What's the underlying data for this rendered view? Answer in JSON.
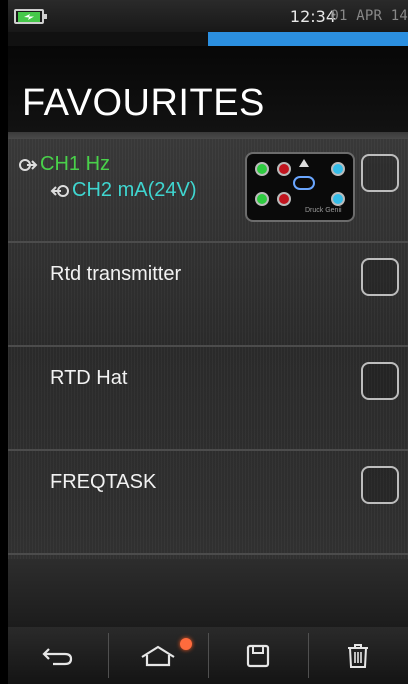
{
  "status": {
    "time": "12:34",
    "date": "01 APR 14",
    "battery_icon": "battery-charging-icon",
    "progress": 0.5
  },
  "header": {
    "title": "FAVOURITES"
  },
  "favourites": [
    {
      "channels": [
        {
          "label": "CH1 Hz",
          "color": "#49d14a"
        },
        {
          "label": "CH2 mA(24V)",
          "color": "#3fd6d0"
        }
      ],
      "device_brand": "Druck Genii",
      "checked": false
    },
    {
      "label": "Rtd transmitter",
      "checked": false
    },
    {
      "label": "RTD Hat",
      "checked": false
    },
    {
      "label": "FREQTASK",
      "checked": false
    }
  ],
  "navbar": {
    "items": [
      {
        "icon": "back-icon"
      },
      {
        "icon": "home-icon",
        "notification": true,
        "notification_color": "#ff6b3d"
      },
      {
        "icon": "save-icon"
      },
      {
        "icon": "trash-icon"
      }
    ]
  },
  "colors": {
    "accent": "#2b8fe0",
    "ch1": "#49d14a",
    "ch2": "#3fd6d0"
  }
}
